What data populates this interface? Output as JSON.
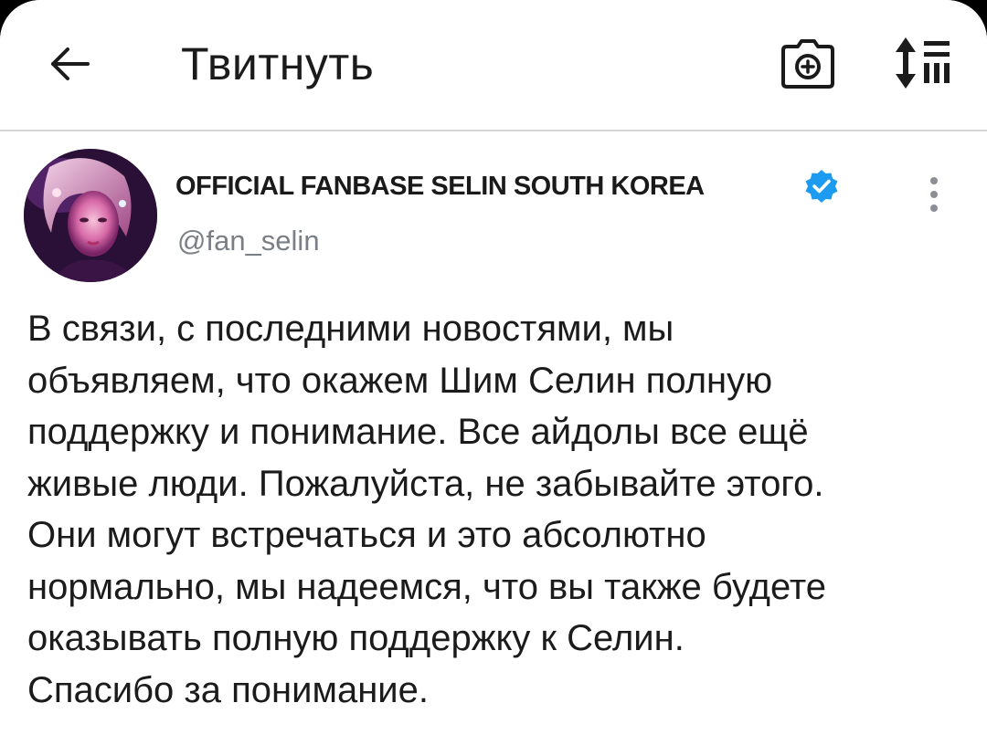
{
  "app_bar": {
    "title": "Твитнуть",
    "back_icon": "arrow-left-icon",
    "camera_icon": "camera-add-icon",
    "sort_icon": "sort-list-icon"
  },
  "tweet": {
    "author": {
      "display_name": "OFFICIAL FANBASE SELIN SOUTH KOREA",
      "handle": "@fan_selin",
      "verified": true
    },
    "text_lines": [
      "В связи, с последними новостями, мы",
      "объявляем, что окажем Шим Селин полную",
      "поддержку и понимание. Все айдолы все ещё",
      "живые люди. Пожалуйста, не забывайте этого.",
      "Они могут встречаться и это абсолютно",
      "нормально, мы надеемся, что вы также будете",
      "оказывать полную поддержку к Селин.",
      "Спасибо за понимание."
    ]
  },
  "colors": {
    "verified_blue": "#1d9bf0",
    "text": "#1b1b1b",
    "secondary_text": "#7a7f85",
    "divider": "#d7d7d7"
  }
}
